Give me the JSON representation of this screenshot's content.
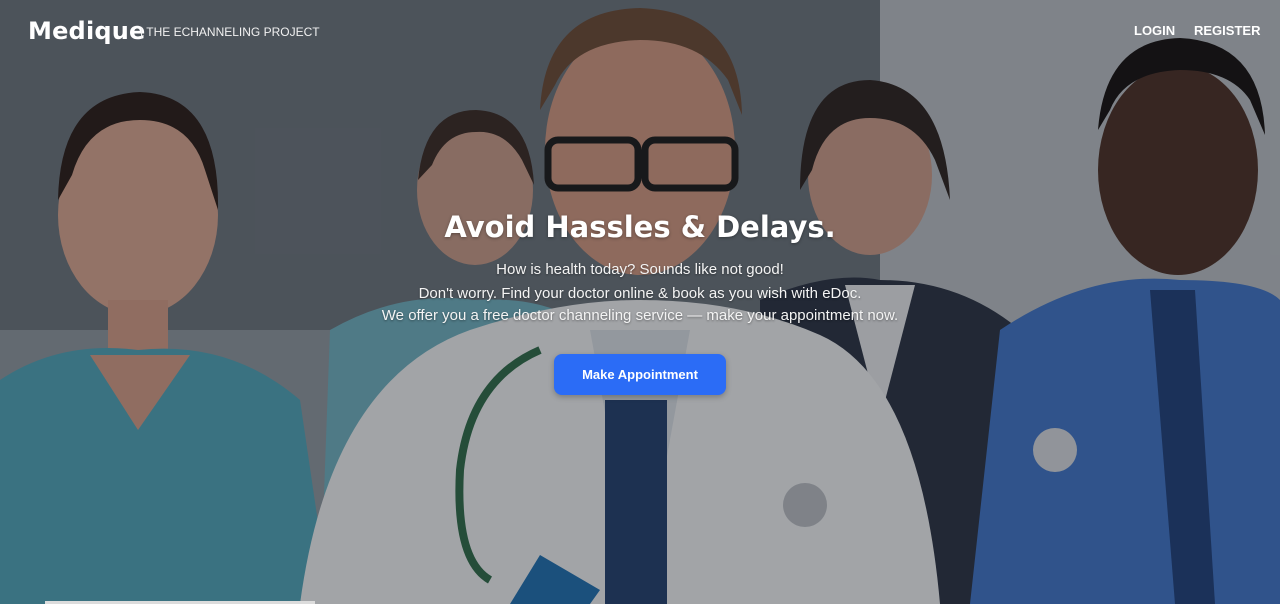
{
  "header": {
    "brand": "Medique",
    "tagline": "| THE ECHANNELING PROJECT",
    "nav": {
      "login": "LOGIN",
      "register": "REGISTER"
    }
  },
  "hero": {
    "title": "Avoid Hassles & Delays.",
    "lines": [
      "How is health today? Sounds like not good!",
      "Don't worry. Find your doctor online & book as you wish with eDoc.",
      "We offer you a free doctor channeling service — make your appointment now."
    ],
    "cta_label": "Make Appointment",
    "background_image": "medical-team-photo"
  },
  "colors": {
    "accent": "#2b6cf6",
    "text": "#ffffff"
  }
}
